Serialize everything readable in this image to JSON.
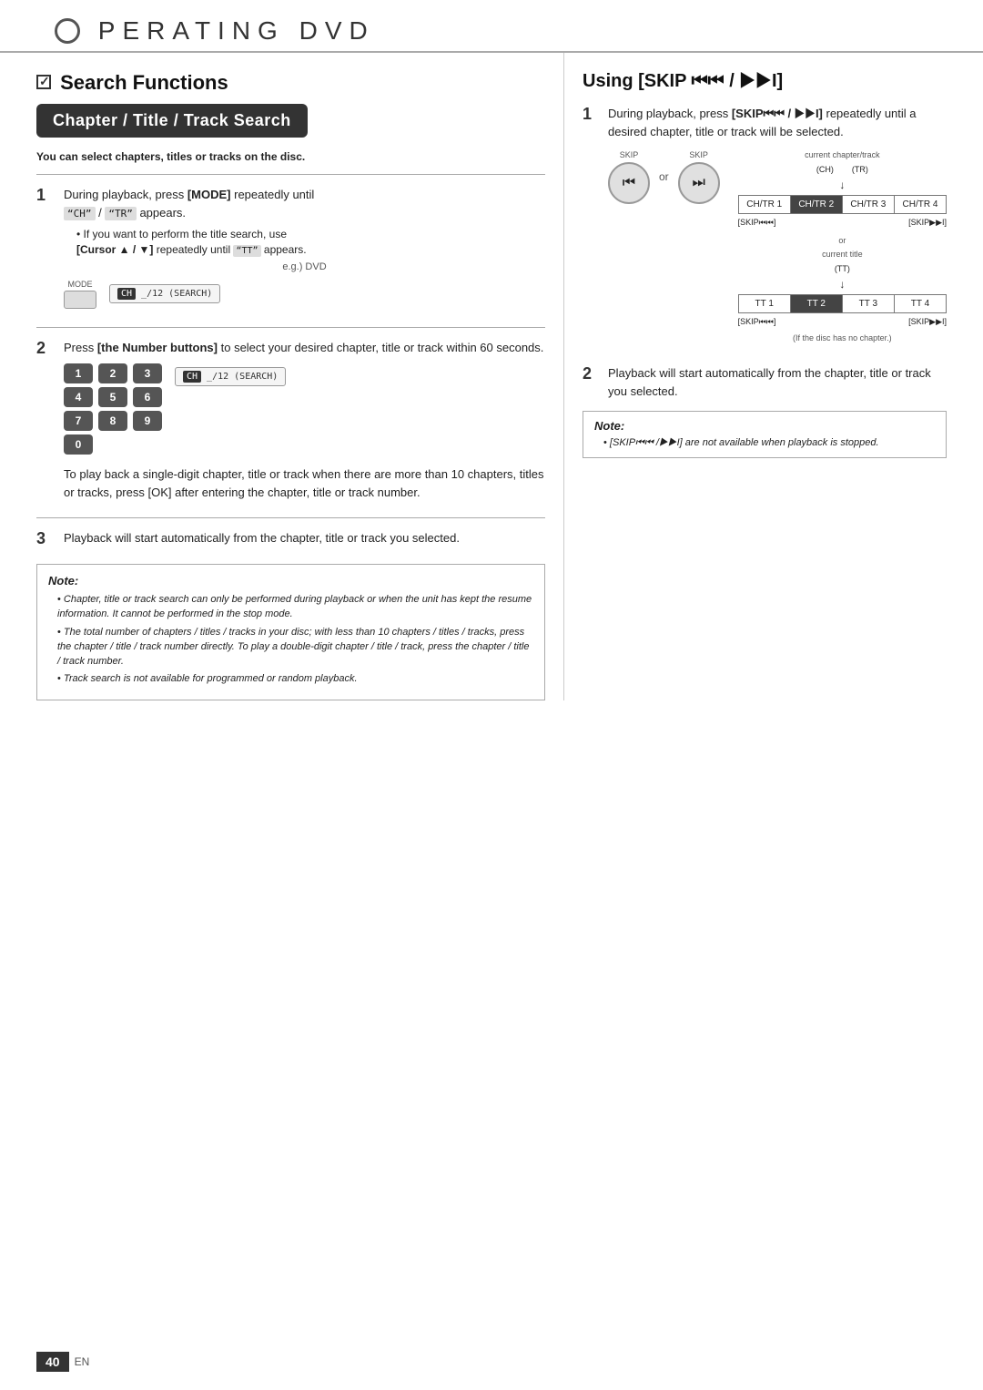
{
  "header": {
    "title": "PERATING   DVD",
    "o_letter": "O"
  },
  "left": {
    "section_title": "Search Functions",
    "banner": "Chapter / Title / Track Search",
    "subtitle": "You can select chapters, titles or tracks on the disc.",
    "step1": {
      "number": "1",
      "text": "During playback, press [MODE] repeatedly until",
      "display_code": "“CH” / “TR” appears.",
      "sub1": "If you want to perform the title search, use",
      "sub1b": "[Cursor ▲ / ▼] repeatedly until “TT” appears.",
      "eg_label": "e.g.) DVD",
      "mode_label": "MODE",
      "screen_text": "CH  _/12 (SEARCH)"
    },
    "step2": {
      "number": "2",
      "text": "Press [the Number buttons] to select your desired chapter, title or track within 60 seconds.",
      "buttons": [
        "1",
        "2",
        "3",
        "4",
        "5",
        "6",
        "7",
        "8",
        "9",
        "0"
      ],
      "screen_text": "CH  _/12 (SEARCH)"
    },
    "step2_note": "To play back a single-digit chapter, title or track when there are more than 10 chapters, titles or tracks, press [OK] after entering the chapter, title or track number.",
    "step3": {
      "number": "3",
      "text": "Playback will start automatically from the chapter, title or track you selected."
    },
    "note": {
      "title": "Note:",
      "bullets": [
        "Chapter, title or track search can only be performed during playback or when the unit has kept the resume information. It cannot be performed in the stop mode.",
        "The total number of chapters / titles / tracks in your disc; with less than 10 chapters / titles / tracks, press the chapter / title / track number directly. To play a double-digit chapter / title / track, press the chapter / title / track number.",
        "Track search is not available for programmed or random playback."
      ]
    }
  },
  "right": {
    "section_title": "Using [SKIP",
    "section_title2": " / ",
    "section_title3": "I]",
    "step1": {
      "number": "1",
      "text": "During playback, press [SKIP⏮ / ▶▶I] repeatedly until a desired chapter, title or track will be selected."
    },
    "diagram": {
      "current_chapter_track": "current chapter/track",
      "ch_tr": "(CH)    (TR)",
      "skip_label_left": "SKIP",
      "skip_label_right": "SKIP",
      "table_rows": [
        [
          "CH/TR 1",
          "CH/TR 2",
          "CH/TR 3",
          "CH/TR 4"
        ]
      ],
      "skip_left_label": "[SKIP⏮⏮]",
      "skip_right_label": "[SKIP▶▶I]",
      "or_text": "or",
      "current_title": "current title",
      "tt": "(TT)",
      "tt_rows": [
        [
          "TT 1",
          "TT 2",
          "TT 3",
          "TT 4"
        ]
      ],
      "tt_skip_left": "[SKIP⏮⏮]",
      "tt_skip_right": "[SKIP▶▶I]",
      "disc_note": "(If the disc has no chapter.)"
    },
    "step2": {
      "number": "2",
      "text": "Playback will start automatically from the chapter, title or track you selected."
    },
    "note": {
      "title": "Note:",
      "bullet": "[SKIP⏮⏮ /▶▶I] are not available when playback is stopped."
    }
  },
  "footer": {
    "page_number": "40",
    "lang": "EN"
  }
}
